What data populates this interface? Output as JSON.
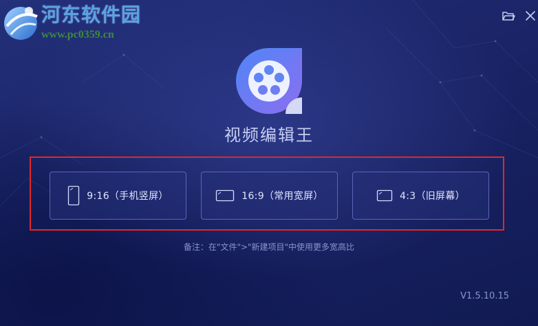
{
  "watermark": {
    "title": "河东软件园",
    "url": "www.pc0359.cn"
  },
  "app": {
    "title": "视频编辑王",
    "version": "V1.5.10.15"
  },
  "controls": {
    "folder_icon": "folder-open-icon",
    "close_icon": "close-icon"
  },
  "aspect_options": [
    {
      "label": "9:16（手机竖屏）",
      "icon": "portrait-screen-icon"
    },
    {
      "label": "16:9（常用宽屏）",
      "icon": "widescreen-icon"
    },
    {
      "label": "4:3（旧屏幕）",
      "icon": "classic-screen-icon"
    }
  ],
  "note": "备注：在\"文件\">\"新建项目\"中使用更多宽高比",
  "colors": {
    "highlight": "#e5262b",
    "logo_gradient_start": "#5b8df5",
    "logo_gradient_end": "#8a6ff0",
    "background": "#1a2466"
  }
}
